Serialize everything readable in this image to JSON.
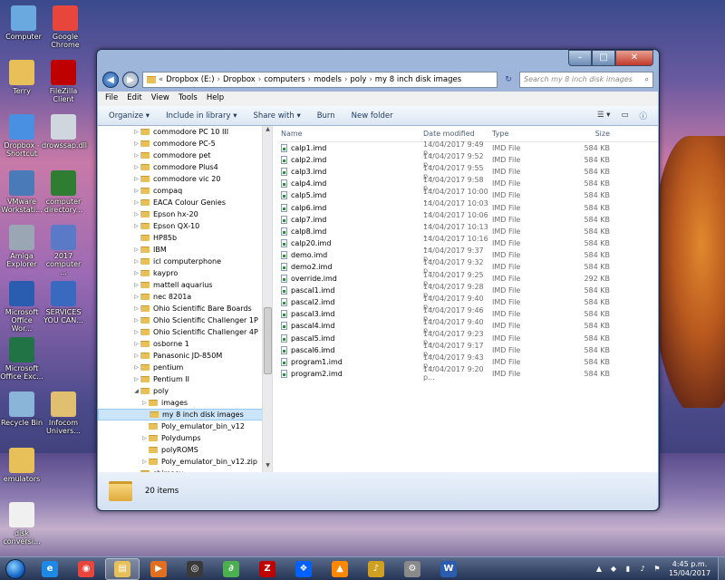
{
  "desktop": {
    "icons": [
      {
        "label": "Computer",
        "icon": "computer-icon",
        "color": "#6aa8e0"
      },
      {
        "label": "Google Chrome",
        "icon": "chrome-icon",
        "color": "#e8453c"
      },
      {
        "label": "Terry",
        "icon": "user-folder-icon",
        "color": "#e8c05a"
      },
      {
        "label": "FileZilla Client",
        "icon": "filezilla-icon",
        "color": "#bf0000"
      },
      {
        "label": "Dropbox - Shortcut",
        "icon": "dropbox-folder-icon",
        "color": "#4a90e2"
      },
      {
        "label": "drowssap.dll",
        "icon": "dll-file-icon",
        "color": "#cfd6de"
      },
      {
        "label": "VMware Workstati...",
        "icon": "vmware-icon",
        "color": "#4a7ab8"
      },
      {
        "label": "computer directory...",
        "icon": "excel-file-icon",
        "color": "#2e7d32"
      },
      {
        "label": "Amiga Explorer",
        "icon": "amiga-icon",
        "color": "#9aa6b4"
      },
      {
        "label": "2017 computer ...",
        "icon": "document-file-icon",
        "color": "#5a7ac8"
      },
      {
        "label": "Microsoft Office Wor...",
        "icon": "word-icon",
        "color": "#2a5cb0"
      },
      {
        "label": "SERVICES YOU CAN...",
        "icon": "word-document-icon",
        "color": "#3a6ac0"
      },
      {
        "label": "Microsoft Office Exc...",
        "icon": "excel-icon",
        "color": "#217346"
      },
      {
        "label": "Recycle Bin",
        "icon": "recycle-bin-icon",
        "color": "#8ab4d8"
      },
      {
        "label": "Infocom Univers...",
        "icon": "infocom-icon",
        "color": "#e0c070"
      },
      {
        "label": "emulators",
        "icon": "folder-icon",
        "color": "#e8c05a"
      },
      {
        "label": "disk conversi...",
        "icon": "document-icon",
        "color": "#f0f0f0"
      }
    ]
  },
  "window": {
    "breadcrumb": [
      "Dropbox (E:)",
      "Dropbox",
      "computers",
      "models",
      "poly",
      "my 8 inch disk images"
    ],
    "search_placeholder": "Search my 8 inch disk images",
    "menu": [
      "File",
      "Edit",
      "View",
      "Tools",
      "Help"
    ],
    "toolbar": {
      "organize": "Organize ▾",
      "include": "Include in library ▾",
      "share": "Share with ▾",
      "burn": "Burn",
      "new_folder": "New folder"
    },
    "columns": {
      "name": "Name",
      "date": "Date modified",
      "type": "Type",
      "size": "Size"
    },
    "status": "20 items"
  },
  "nav_tree": [
    {
      "label": "commodore PC 10 III",
      "arrow": "▷",
      "depth": 0
    },
    {
      "label": "commodore PC-5",
      "arrow": "▷",
      "depth": 0
    },
    {
      "label": "commodore pet",
      "arrow": "▷",
      "depth": 0
    },
    {
      "label": "commodore Plus4",
      "arrow": "▷",
      "depth": 0
    },
    {
      "label": "commodore vic 20",
      "arrow": "▷",
      "depth": 0
    },
    {
      "label": "compaq",
      "arrow": "▷",
      "depth": 0
    },
    {
      "label": "EACA Colour Genies",
      "arrow": "▷",
      "depth": 0
    },
    {
      "label": "Epson hx-20",
      "arrow": "▷",
      "depth": 0
    },
    {
      "label": "Epson QX-10",
      "arrow": "▷",
      "depth": 0
    },
    {
      "label": "HP85b",
      "arrow": "",
      "depth": 0
    },
    {
      "label": "IBM",
      "arrow": "▷",
      "depth": 0
    },
    {
      "label": "icl computerphone",
      "arrow": "▷",
      "depth": 0
    },
    {
      "label": "kaypro",
      "arrow": "▷",
      "depth": 0
    },
    {
      "label": "mattell aquarius",
      "arrow": "▷",
      "depth": 0
    },
    {
      "label": "nec 8201a",
      "arrow": "▷",
      "depth": 0
    },
    {
      "label": "Ohio Scientific Bare Boards",
      "arrow": "▷",
      "depth": 0
    },
    {
      "label": "Ohio Scientific Challenger 1P",
      "arrow": "▷",
      "depth": 0
    },
    {
      "label": "Ohio Scientific Challenger 4P",
      "arrow": "▷",
      "depth": 0
    },
    {
      "label": "osborne 1",
      "arrow": "▷",
      "depth": 0
    },
    {
      "label": "Panasonic JD-850M",
      "arrow": "▷",
      "depth": 0
    },
    {
      "label": "pentium",
      "arrow": "▷",
      "depth": 0
    },
    {
      "label": "Pentium II",
      "arrow": "▷",
      "depth": 0
    },
    {
      "label": "poly",
      "arrow": "◢",
      "depth": 0
    },
    {
      "label": "images",
      "arrow": "▷",
      "depth": 1
    },
    {
      "label": "my 8 inch disk images",
      "arrow": "",
      "depth": 1,
      "selected": true
    },
    {
      "label": "Poly_emulator_bin_v12",
      "arrow": "",
      "depth": 1
    },
    {
      "label": "Polydumps",
      "arrow": "▷",
      "depth": 1
    },
    {
      "label": "polyROMS",
      "arrow": "",
      "depth": 1
    },
    {
      "label": "Poly_emulator_bin_v12.zip",
      "arrow": "▷",
      "depth": 1
    },
    {
      "label": "shimasu",
      "arrow": "",
      "depth": 0
    }
  ],
  "files": [
    {
      "name": "calp1.imd",
      "date": "14/04/2017 9:49 p...",
      "type": "IMD File",
      "size": "584 KB"
    },
    {
      "name": "calp2.imd",
      "date": "14/04/2017 9:52 p...",
      "type": "IMD File",
      "size": "584 KB"
    },
    {
      "name": "calp3.imd",
      "date": "14/04/2017 9:55 p...",
      "type": "IMD File",
      "size": "584 KB"
    },
    {
      "name": "calp4.imd",
      "date": "14/04/2017 9:58 p...",
      "type": "IMD File",
      "size": "584 KB"
    },
    {
      "name": "calp5.imd",
      "date": "14/04/2017 10:00 ...",
      "type": "IMD File",
      "size": "584 KB"
    },
    {
      "name": "calp6.imd",
      "date": "14/04/2017 10:03 ...",
      "type": "IMD File",
      "size": "584 KB"
    },
    {
      "name": "calp7.imd",
      "date": "14/04/2017 10:06 ...",
      "type": "IMD File",
      "size": "584 KB"
    },
    {
      "name": "calp8.imd",
      "date": "14/04/2017 10:13 ...",
      "type": "IMD File",
      "size": "584 KB"
    },
    {
      "name": "calp20.imd",
      "date": "14/04/2017 10:16 ...",
      "type": "IMD File",
      "size": "584 KB"
    },
    {
      "name": "demo.imd",
      "date": "14/04/2017 9:37 p...",
      "type": "IMD File",
      "size": "584 KB"
    },
    {
      "name": "demo2.imd",
      "date": "14/04/2017 9:32 p...",
      "type": "IMD File",
      "size": "584 KB"
    },
    {
      "name": "override.imd",
      "date": "14/04/2017 9:25 p...",
      "type": "IMD File",
      "size": "292 KB"
    },
    {
      "name": "pascal1.imd",
      "date": "14/04/2017 9:28 p...",
      "type": "IMD File",
      "size": "584 KB"
    },
    {
      "name": "pascal2.imd",
      "date": "14/04/2017 9:40 p...",
      "type": "IMD File",
      "size": "584 KB"
    },
    {
      "name": "pascal3.imd",
      "date": "14/04/2017 9:46 p...",
      "type": "IMD File",
      "size": "584 KB"
    },
    {
      "name": "pascal4.imd",
      "date": "14/04/2017 9:40 p...",
      "type": "IMD File",
      "size": "584 KB"
    },
    {
      "name": "pascal5.imd",
      "date": "14/04/2017 9:23 p...",
      "type": "IMD File",
      "size": "584 KB"
    },
    {
      "name": "pascal6.imd",
      "date": "14/04/2017 9:17 p...",
      "type": "IMD File",
      "size": "584 KB"
    },
    {
      "name": "program1.imd",
      "date": "14/04/2017 9:43 p...",
      "type": "IMD File",
      "size": "584 KB"
    },
    {
      "name": "program2.imd",
      "date": "14/04/2017 9:20 p...",
      "type": "IMD File",
      "size": "584 KB"
    }
  ],
  "taskbar": {
    "apps": [
      {
        "icon": "internet-explorer-icon",
        "glyph": "e",
        "color": "#1e88e5"
      },
      {
        "icon": "chrome-icon",
        "glyph": "◉",
        "color": "#e8453c"
      },
      {
        "icon": "windows-explorer-icon",
        "glyph": "▤",
        "color": "#e8c05a",
        "active": true
      },
      {
        "icon": "media-player-icon",
        "glyph": "▶",
        "color": "#e07020"
      },
      {
        "icon": "eye-app-icon",
        "glyph": "◎",
        "color": "#3a3a3a"
      },
      {
        "icon": "green-app-icon",
        "glyph": "∂",
        "color": "#4caf50"
      },
      {
        "icon": "filezilla-icon",
        "glyph": "Z",
        "color": "#bf0000"
      },
      {
        "icon": "dropbox-icon",
        "glyph": "❖",
        "color": "#0061fe"
      },
      {
        "icon": "vlc-icon",
        "glyph": "▲",
        "color": "#ff8800"
      },
      {
        "icon": "audio-app-icon",
        "glyph": "♪",
        "color": "#d0a020"
      },
      {
        "icon": "network-tool-icon",
        "glyph": "⚙",
        "color": "#8a8a8a"
      },
      {
        "icon": "word-icon",
        "glyph": "W",
        "color": "#2a5cb0"
      }
    ],
    "clock": {
      "time": "4:45 p.m.",
      "date": "15/04/2017"
    }
  }
}
